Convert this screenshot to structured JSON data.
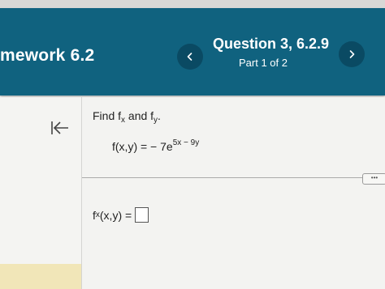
{
  "header": {
    "homework_title": "mework 6.2",
    "question_title": "Question 3, 6.2.9",
    "part": "Part 1 of 2"
  },
  "problem": {
    "prompt_find": "Find f",
    "prompt_fx_sub": "x",
    "prompt_and": " and f",
    "prompt_fy_sub": "y",
    "prompt_end": ".",
    "function_lhs": "f(x,y) = − 7e",
    "function_exponent": "5x − 9y"
  },
  "answer": {
    "label_f": "f",
    "label_sub": "x",
    "label_rest": "(x,y) ="
  },
  "more_button_label": "•••",
  "colors": {
    "header_bg": "#10627f",
    "nav_button_bg": "#0a4a63",
    "page_bg": "#f1f1ef",
    "left_accent": "#f1e6b8"
  },
  "icons": {
    "prev": "chevron-left-icon",
    "next": "chevron-right-icon",
    "collapse": "collapse-left-icon"
  }
}
